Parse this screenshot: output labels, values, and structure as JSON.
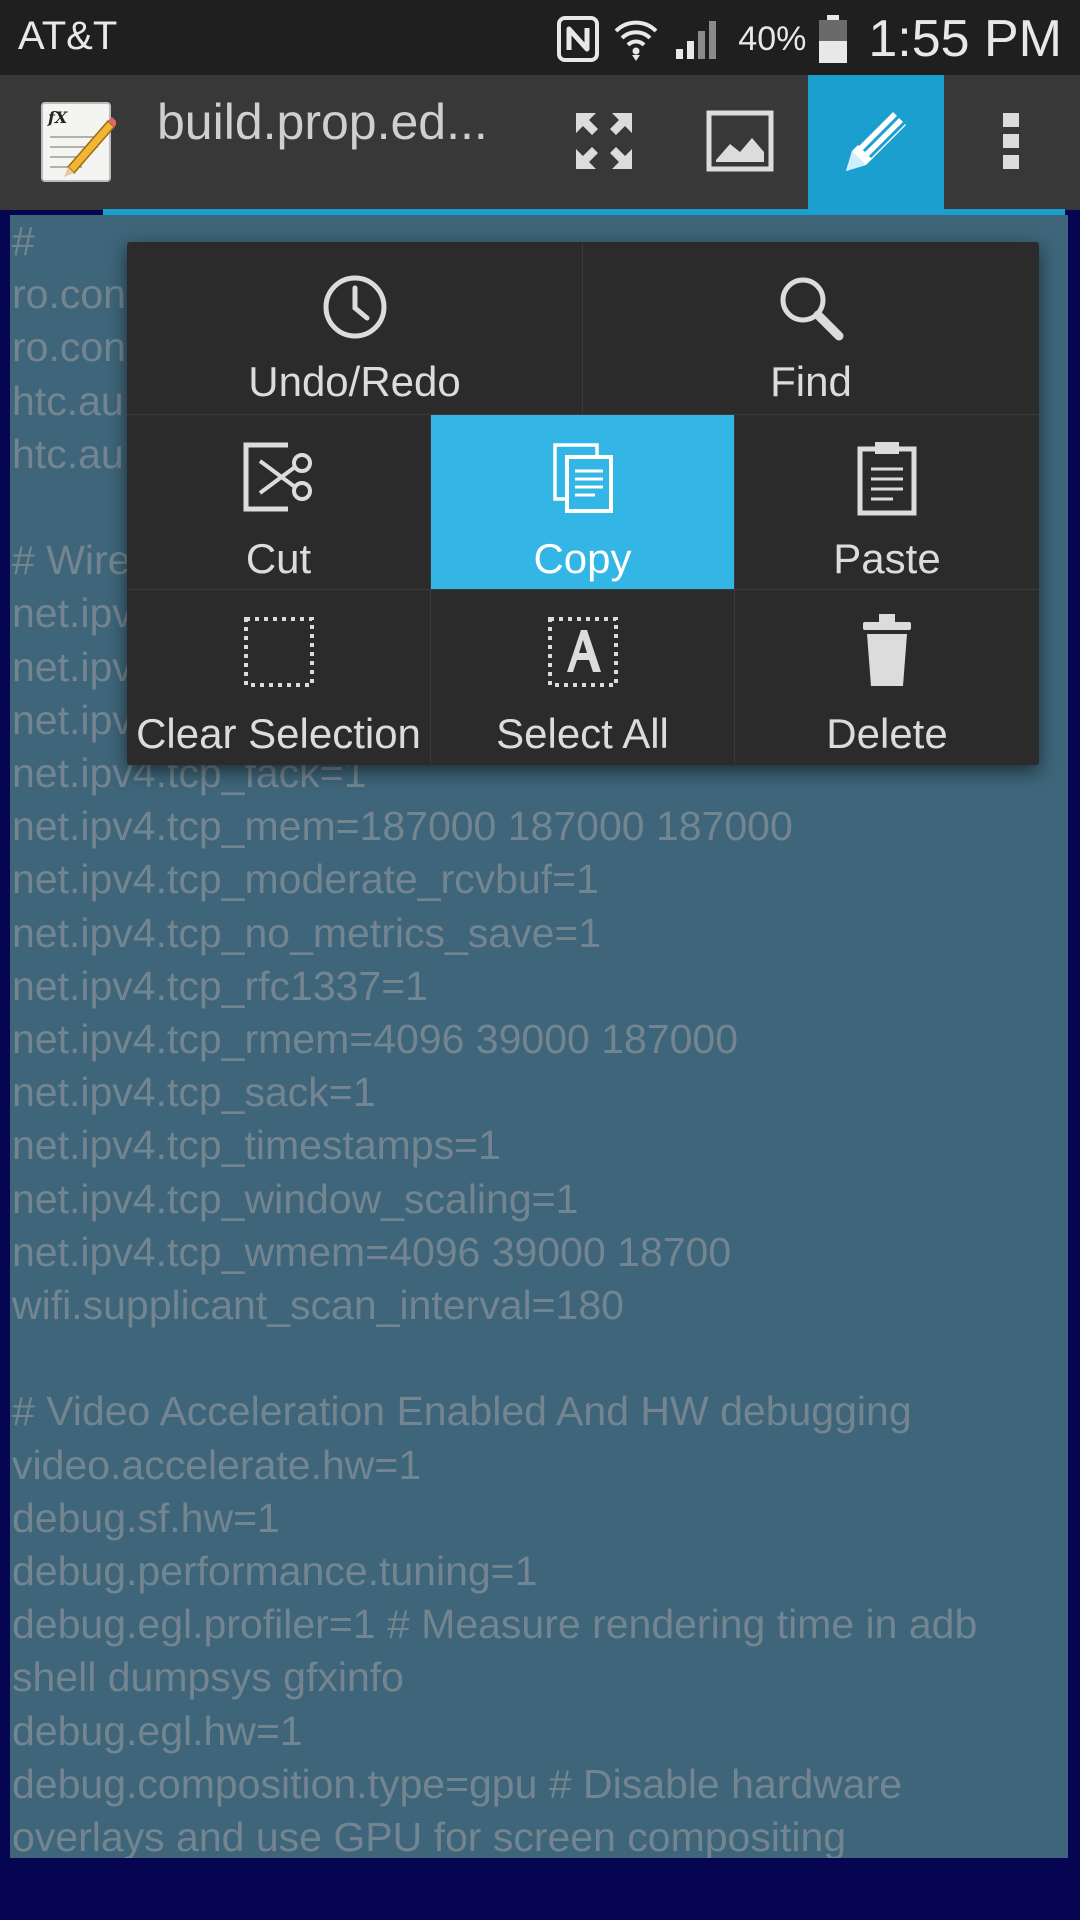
{
  "status_bar": {
    "carrier": "AT&T",
    "battery_percent": "40%",
    "time": "1:55 PM",
    "icons": [
      "nfc-icon",
      "wifi-icon",
      "signal-icon",
      "battery-icon"
    ]
  },
  "action_bar": {
    "title": "build.prop.ed...",
    "buttons": [
      "fullscreen-icon",
      "image-icon",
      "pencil-icon",
      "overflow-menu-icon"
    ],
    "accent_color": "#1a9fce"
  },
  "menu": {
    "undo_redo": "Undo/Redo",
    "find": "Find",
    "cut": "Cut",
    "copy": "Copy",
    "paste": "Paste",
    "clear_selection": "Clear Selection",
    "select_all": "Select All",
    "delete": "Delete",
    "selected_item": "Copy",
    "highlight_color": "#33b5e5"
  },
  "editor": {
    "lines": [
      "#",
      "ro.con",
      "ro.con",
      "htc.au",
      "htc.au",
      "",
      "# Wire",
      "net.ipv",
      "net.ipv",
      "net.ipv",
      "net.ipv4.tcp_fack=1",
      "net.ipv4.tcp_mem=187000 187000 187000",
      "net.ipv4.tcp_moderate_rcvbuf=1",
      "net.ipv4.tcp_no_metrics_save=1",
      "net.ipv4.tcp_rfc1337=1",
      "net.ipv4.tcp_rmem=4096 39000 187000",
      "net.ipv4.tcp_sack=1",
      "net.ipv4.tcp_timestamps=1",
      "net.ipv4.tcp_window_scaling=1",
      "net.ipv4.tcp_wmem=4096 39000 18700",
      "wifi.supplicant_scan_interval=180",
      "",
      "# Video Acceleration Enabled And HW debugging",
      "video.accelerate.hw=1",
      "debug.sf.hw=1",
      "debug.performance.tuning=1",
      "debug.egl.profiler=1 # Measure rendering time in adb",
      "shell dumpsys gfxinfo",
      "debug.egl.hw=1",
      "debug.composition.type=gpu # Disable hardware",
      "overlays and use GPU for screen compositing"
    ]
  }
}
